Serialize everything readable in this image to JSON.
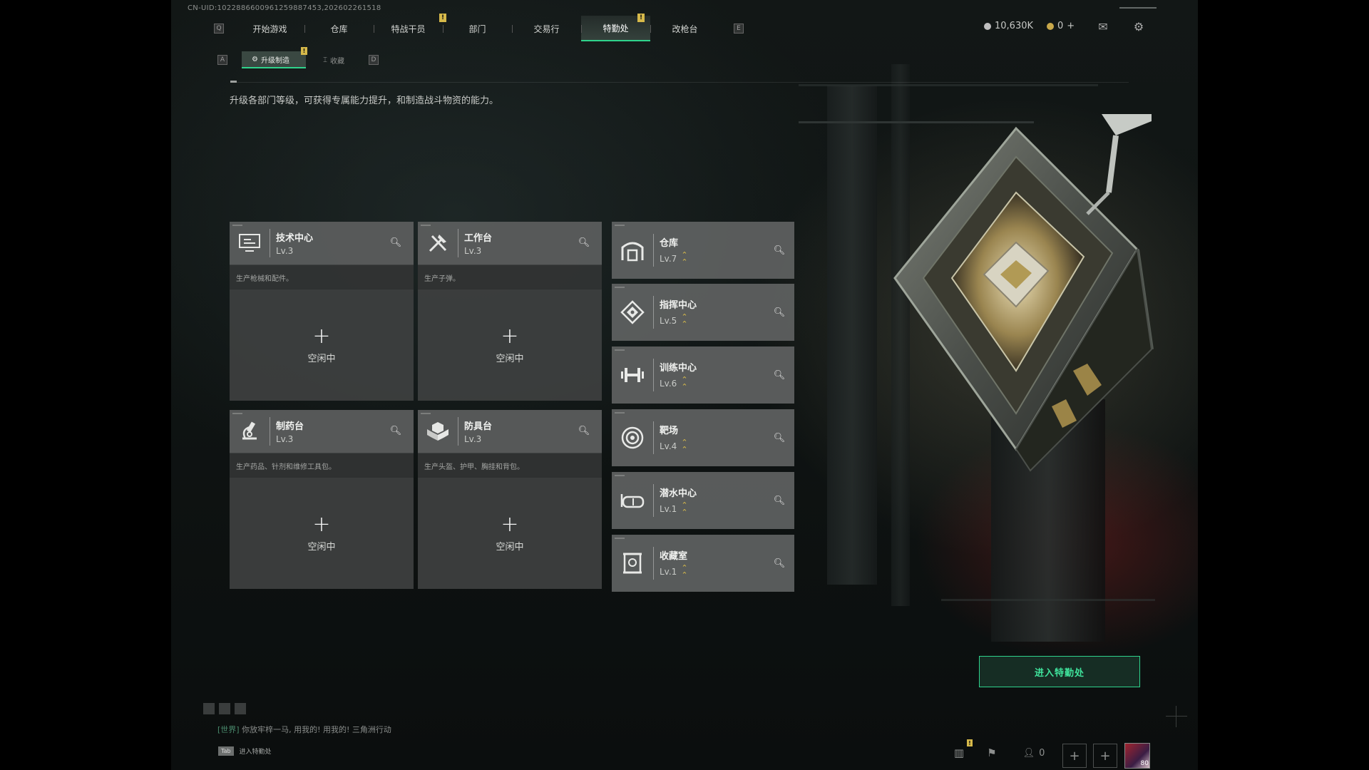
{
  "uid_text": "CN-UID:1022886600961259887453,202602261518",
  "nav": {
    "left_key": "Q",
    "right_key": "E",
    "tabs": [
      {
        "label": "开始游戏",
        "active": false,
        "alert": ""
      },
      {
        "label": "仓库",
        "active": false,
        "alert": ""
      },
      {
        "label": "特战干员",
        "active": false,
        "alert": ""
      },
      {
        "label": "部门",
        "active": false,
        "alert": "!"
      },
      {
        "label": "交易行",
        "active": false,
        "alert": ""
      },
      {
        "label": "特勤处",
        "active": true,
        "alert": "!"
      },
      {
        "label": "改枪台",
        "active": false,
        "alert": ""
      }
    ]
  },
  "currency": {
    "silver": "10,630K",
    "gold": "0",
    "add_symbol": "+"
  },
  "top_icons": {
    "mail": "mail-icon",
    "settings": "gear-icon"
  },
  "subtabs": {
    "left_key": "A",
    "right_key": "D",
    "items": [
      {
        "label": "升级制造",
        "active": true,
        "alert": "!"
      },
      {
        "label": "收藏",
        "active": false,
        "alert": ""
      }
    ]
  },
  "description": "升级各部门等级，可获得专属能力提升，和制造战斗物资的能力。",
  "production": [
    {
      "name": "技术中心",
      "level": "Lv.3",
      "desc": "生产枪械和配件。",
      "status": "空闲中",
      "icon": "monitor-icon"
    },
    {
      "name": "工作台",
      "level": "Lv.3",
      "desc": "生产子弹。",
      "status": "空闲中",
      "icon": "tools-icon"
    },
    {
      "name": "制药台",
      "level": "Lv.3",
      "desc": "生产药品、针剂和维修工具包。",
      "status": "空闲中",
      "icon": "microscope-icon"
    },
    {
      "name": "防具台",
      "level": "Lv.3",
      "desc": "生产头盔、护甲、胸挂和背包。",
      "status": "空闲中",
      "icon": "armor-icon"
    }
  ],
  "facilities": [
    {
      "name": "仓库",
      "level": "Lv.7",
      "icon": "warehouse-icon",
      "upgradable": true
    },
    {
      "name": "指挥中心",
      "level": "Lv.5",
      "icon": "command-icon",
      "upgradable": true
    },
    {
      "name": "训练中心",
      "level": "Lv.6",
      "icon": "dumbbell-icon",
      "upgradable": true
    },
    {
      "name": "靶场",
      "level": "Lv.4",
      "icon": "target-icon",
      "upgradable": true
    },
    {
      "name": "潜水中心",
      "level": "Lv.1",
      "icon": "diving-mask-icon",
      "upgradable": true
    },
    {
      "name": "收藏室",
      "level": "Lv.1",
      "icon": "trophy-icon",
      "upgradable": true
    }
  ],
  "enter_button": "进入特勤处",
  "chat": {
    "channel": "[世界]",
    "message": "你放牢梓一马, 用我的! 用我的! 三角洲行动"
  },
  "tab_hint": {
    "key": "Tab",
    "label": "进入特勤处"
  },
  "bottom": {
    "friends_count": "0",
    "avatar_level": "80"
  },
  "colors": {
    "accent": "#2fd38c",
    "alert": "#d6b94a",
    "card": "#5c5e5e"
  }
}
